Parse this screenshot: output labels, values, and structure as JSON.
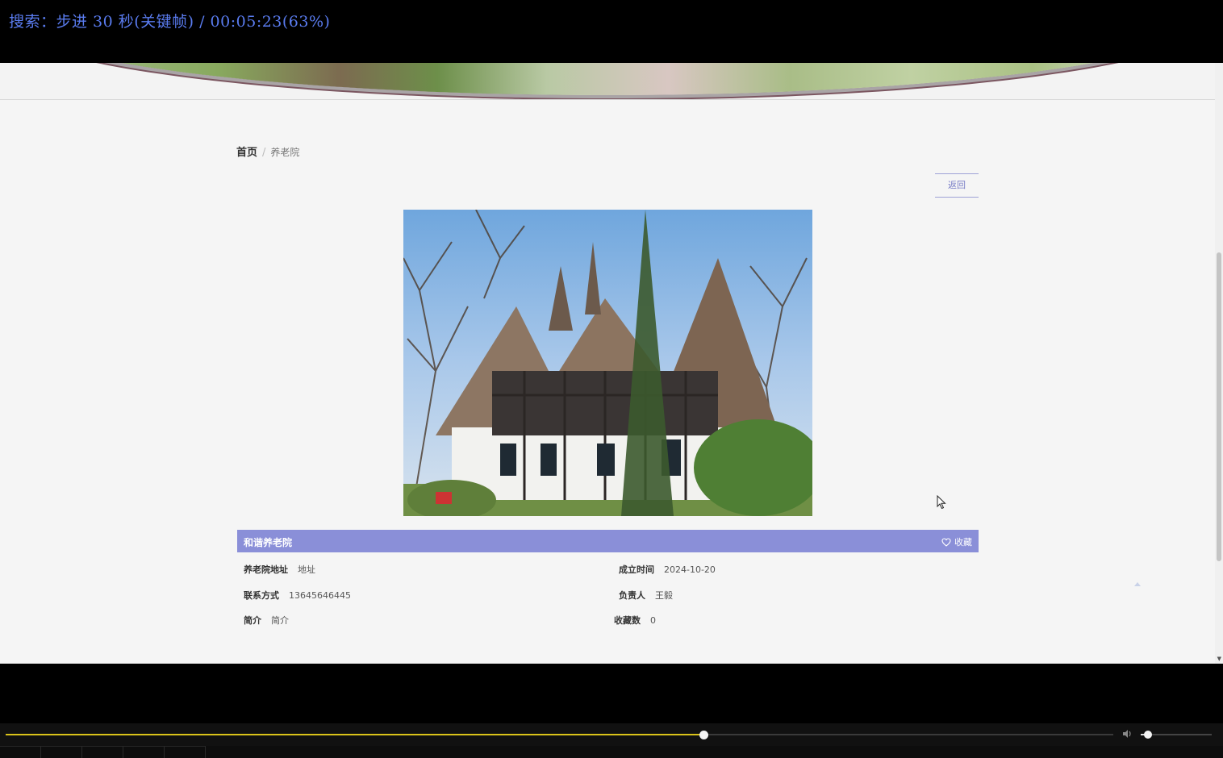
{
  "osd": {
    "text": "搜索：步进 30 秒(关键帧) / 00:05:23(63%)"
  },
  "breadcrumb": {
    "home": "首页",
    "separator": "/",
    "current": "养老院"
  },
  "back_button": "返回",
  "detail": {
    "name": "和谐养老院",
    "favorite_label": "收藏",
    "fields": [
      {
        "label": "养老院地址",
        "value": "地址"
      },
      {
        "label": "成立时间",
        "value": "2024-10-20"
      },
      {
        "label": "联系方式",
        "value": "13645646445"
      },
      {
        "label": "负责人",
        "value": "王毅"
      },
      {
        "label": "简介",
        "value": "简介"
      },
      {
        "label": "收藏数",
        "value": "0"
      }
    ]
  },
  "player": {
    "progress_fraction": 0.63,
    "volume_fraction": 0.1
  },
  "colors": {
    "osd_text": "#5a7cf0",
    "accent": "#8a8fd8",
    "seek_fill": "#d9c21a"
  },
  "icons": {
    "favorite": "heart-outline-icon",
    "volume": "speaker-icon",
    "to_top": "arrow-up-icon",
    "cursor": "mouse-pointer-icon"
  }
}
